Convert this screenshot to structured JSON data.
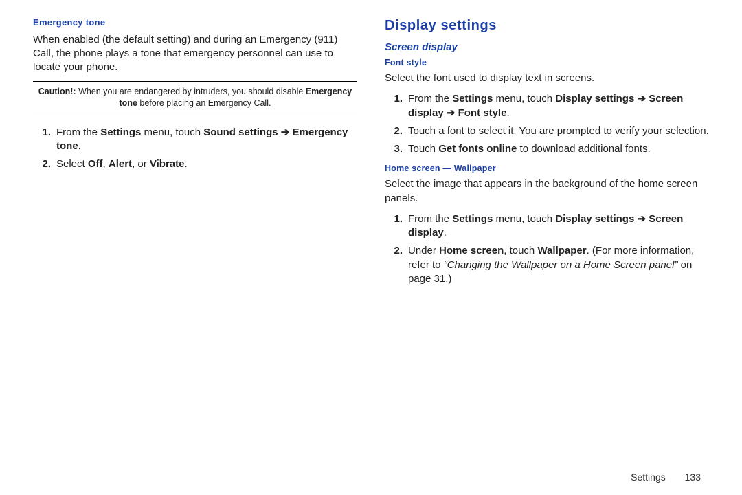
{
  "left": {
    "heading": "Emergency tone",
    "intro": "When enabled (the default setting) and during an Emergency (911) Call, the phone plays a tone that emergency personnel can use to locate your phone.",
    "caution_prefix": "Caution!:",
    "caution_text1": " When you are endangered by intruders, you should disable ",
    "caution_bold": "Emergency tone",
    "caution_text2": " before placing an Emergency Call.",
    "step1_n": "1.",
    "step1_a": "From the ",
    "step1_b": "Settings",
    "step1_c": " menu, touch ",
    "step1_d": "Sound settings",
    "arrow": " ➔ ",
    "step1_e": "Emergency tone",
    "step1_f": ".",
    "step2_n": "2.",
    "step2_a": "Select ",
    "step2_b": "Off",
    "step2_c": ", ",
    "step2_d": "Alert",
    "step2_e": ", or ",
    "step2_f": "Vibrate",
    "step2_g": "."
  },
  "right": {
    "title": "Display settings",
    "sub_screen": "Screen display",
    "font_style_h": "Font style",
    "font_intro": "Select the font used to display text in screens.",
    "fs1_n": "1.",
    "fs1_a": "From the ",
    "fs1_b": "Settings",
    "fs1_c": " menu, touch ",
    "fs1_d": "Display settings",
    "arrow": " ➔ ",
    "fs1_e": "Screen display",
    "fs1_f": "Font style",
    "fs1_g": ".",
    "fs2_n": "2.",
    "fs2_a": "Touch a font to select it. You are prompted to verify your selection.",
    "fs3_n": "3.",
    "fs3_a": "Touch ",
    "fs3_b": "Get fonts online",
    "fs3_c": " to download additional fonts.",
    "home_h": "Home screen — Wallpaper",
    "home_intro": "Select the image that appears in the background of the home screen panels.",
    "hw1_n": "1.",
    "hw1_a": "From the ",
    "hw1_b": "Settings",
    "hw1_c": " menu, touch ",
    "hw1_d": "Display settings",
    "hw1_e": "Screen display",
    "hw1_f": ".",
    "hw2_n": "2.",
    "hw2_a": "Under ",
    "hw2_b": "Home screen",
    "hw2_c": ", touch ",
    "hw2_d": "Wallpaper",
    "hw2_e": ". (For more information, refer to ",
    "hw2_f": "“Changing the Wallpaper on a Home Screen panel”",
    "hw2_g": " on page 31.)"
  },
  "footer": {
    "section": "Settings",
    "page": "133"
  }
}
